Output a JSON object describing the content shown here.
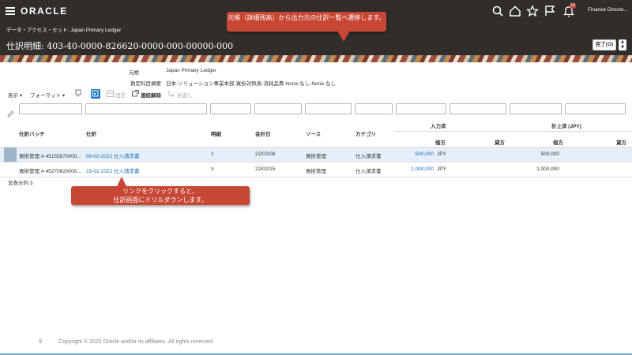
{
  "topbar": {
    "logo": "ORACLE",
    "notification_count": "10",
    "user_name": "Finance Directo..."
  },
  "header": {
    "data_access_label": "データ・アクセス・セット:",
    "data_access_value": "Japan Primary Ledger",
    "title": "仕訳明細: 403-40-0000-826620-0000-000-00000-000",
    "done_label": "完了(O)"
  },
  "callouts": {
    "top": "元帳（詳細残高）から出力元の仕訳一覧へ遷移します。",
    "bottom_line1": "リンクをクリックすると、",
    "bottom_line2": "仕訳画面にドリルダウンします。"
  },
  "info": {
    "ledger_label": "元帳",
    "ledger_value": "Japan Primary Ledger",
    "account_label": "勘定科目摘要",
    "account_value": "日本-ソリューション事業本部-買掛対照表-消耗品費-None-なし-None-なし"
  },
  "toolbar": {
    "view_label": "表示",
    "format_label": "フォーマット",
    "freeze_label": "固定",
    "detach_label": "連結解除",
    "wrap_label": "折返し"
  },
  "table": {
    "columns": {
      "batch": "仕訳バッチ",
      "journal": "仕訳",
      "line": "明細",
      "date": "会計日",
      "source": "ソース",
      "category": "カテゴリ",
      "entered_group": "入力済",
      "accounted_group": "計上済 (JPY)",
      "debit": "借方",
      "credit": "貸方"
    },
    "rows": [
      {
        "batch": "買掛管理 A 45155870000...",
        "journal": "08-02-2022 仕入請求書",
        "line": "3",
        "date": "22/02/08",
        "source": "買掛管理",
        "category": "仕入請求書",
        "entered_debit": "500,000",
        "entered_currency": "JPY",
        "accounted_debit": "500,000"
      },
      {
        "batch": "買掛管理 A 45270620000...",
        "journal": "15-02-2022 仕入請求書",
        "line": "3",
        "date": "22/02/15",
        "source": "買掛管理",
        "category": "仕入請求書",
        "entered_debit": "1,000,000",
        "entered_currency": "JPY",
        "accounted_debit": "1,000,000"
      }
    ],
    "hidden_columns_label": "非表示列",
    "hidden_columns_count": "3"
  },
  "footer": {
    "page_number": "9",
    "copyright": "Copyright © 2025 Oracle and/or its affiliates. All rights reserved."
  },
  "colors": {
    "topbar": "#312d2a",
    "accent": "#c74634",
    "link": "#1a6fb8",
    "row_selected": "#e4eff9"
  }
}
